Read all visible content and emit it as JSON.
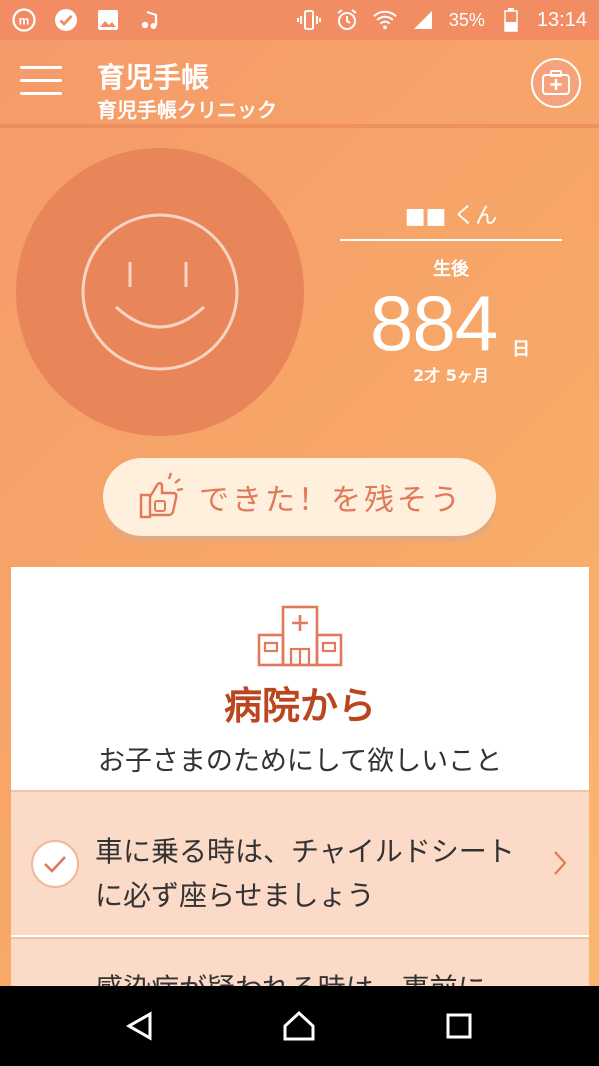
{
  "status_bar": {
    "battery": "35%",
    "time": "13:14",
    "icons": [
      "m-app-icon",
      "check-circle-icon",
      "image-icon",
      "music-icon",
      "vibrate-icon",
      "alarm-icon",
      "wifi-icon",
      "signal-icon",
      "battery-icon"
    ]
  },
  "appbar": {
    "title": "育児手帳",
    "subtitle": "育児手帳クリニック",
    "menu_icon": "hamburger-icon",
    "clinic_icon": "medical-kit-icon"
  },
  "child": {
    "name": "■■ くん",
    "age_label": "生後",
    "days": "884",
    "days_unit": "日",
    "age_years_months": "2才 5ヶ月"
  },
  "record_button": {
    "label": "できた！を残そう",
    "icon": "thumbs-up-icon"
  },
  "card": {
    "icon": "hospital-icon",
    "title": "病院から",
    "subtitle": "お子さまのためにして欲しいこと",
    "tips": [
      {
        "text": "車に乗る時は、チャイルドシートに必ず座らせましょう"
      },
      {
        "text": "感染症が疑われる時は、事前に"
      }
    ]
  },
  "colors": {
    "accent": "#f28d63",
    "title_red": "#b9461f",
    "record_text": "#e1795b",
    "tip_bg": "#fbdac8"
  }
}
